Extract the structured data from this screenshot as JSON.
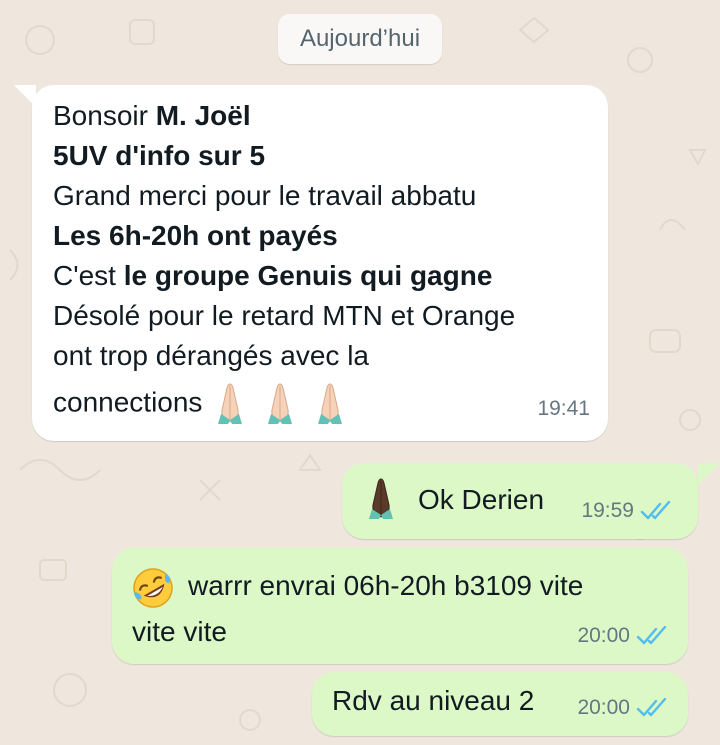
{
  "date_separator": "Aujourd’hui",
  "messages": [
    {
      "direction": "incoming",
      "lines": {
        "l1_plain": "Bonsoir ",
        "l1_bold": "M. Joël",
        "l2_bold": "5UV d'info sur 5",
        "l3_plain": "Grand merci pour le travail abbatu",
        "l4_bold": "Les 6h-20h ont payés",
        "l5_plain": "C'est ",
        "l5_bold": "le groupe Genuis qui gagne",
        "l6_plain": "Désolé pour le retard MTN et Orange",
        "l7_plain": "ont trop dérangés avec la",
        "l8_plain": "connections"
      },
      "emoji": "folded-hands-light",
      "time": "19:41"
    },
    {
      "direction": "outgoing",
      "text": "Ok Derien",
      "emoji": "folded-hands-dark",
      "time": "19:59",
      "status": "read"
    },
    {
      "direction": "outgoing",
      "line1": "warrr envrai 06h-20h b3109 vite",
      "line2": "vite vite",
      "emoji": "rolling-on-floor-laughing",
      "time": "20:00",
      "status": "read"
    },
    {
      "direction": "outgoing",
      "text": "Rdv au niveau 2",
      "time": "20:00",
      "status": "read"
    }
  ],
  "colors": {
    "wallpaper": "#efe7de",
    "incoming_bubble": "#ffffff",
    "outgoing_bubble": "#dcf8c6",
    "read_ticks": "#53bdeb",
    "meta_text": "#667781"
  }
}
